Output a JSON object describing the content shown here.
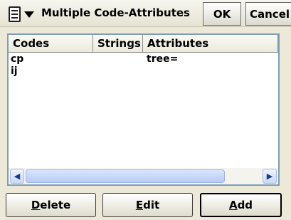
{
  "window": {
    "title": "Multiple Code-Attributes",
    "ok_label": "OK",
    "cancel_label": "Cancel"
  },
  "table": {
    "columns": [
      "Codes",
      "Strings",
      "Attributes"
    ],
    "rows": [
      {
        "code": "cp",
        "strings": "",
        "attributes": "tree="
      },
      {
        "code": "ij",
        "strings": "",
        "attributes": ""
      }
    ]
  },
  "buttons": {
    "delete": {
      "mnemonic": "D",
      "rest": "elete"
    },
    "edit": {
      "mnemonic": "E",
      "rest": "dit"
    },
    "add": {
      "mnemonic": "A",
      "rest": "dd"
    }
  },
  "icons": {
    "menu": "app-menu-icon",
    "scroll_left": "scroll-left-arrow-icon",
    "scroll_right": "scroll-right-arrow-icon"
  }
}
